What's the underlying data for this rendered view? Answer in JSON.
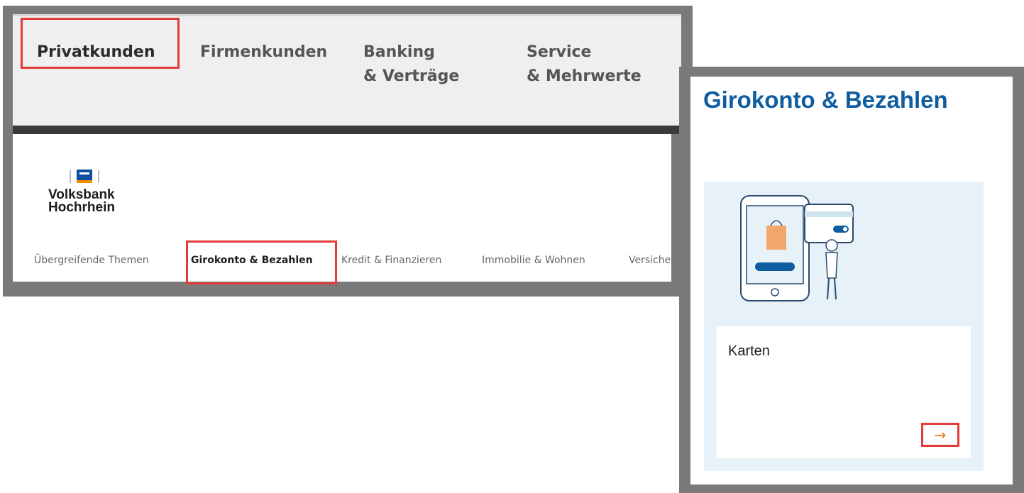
{
  "top_nav": {
    "items": [
      {
        "label": "Privatkunden"
      },
      {
        "label": "Firmenkunden"
      },
      {
        "label": "Banking\n& Verträge"
      },
      {
        "label": "Service\n& Mehrwerte"
      }
    ],
    "active_index": 0
  },
  "brand": {
    "name": "Volksbank\nHochrhein"
  },
  "sub_nav": {
    "items": [
      {
        "label": "Übergreifende Themen"
      },
      {
        "label": "Girokonto & Bezahlen"
      },
      {
        "label": "Kredit & Finanzieren"
      },
      {
        "label": "Immobilie & Wohnen"
      },
      {
        "label": "Versiche"
      }
    ],
    "active_index": 1
  },
  "card": {
    "title": "Girokonto & Bezahlen",
    "tile_label": "Karten",
    "arrow_icon": "arrow-right-icon"
  },
  "colors": {
    "highlight": "#e23b3b",
    "brand_blue": "#0e5da0",
    "accent_orange": "#e27a1b"
  }
}
